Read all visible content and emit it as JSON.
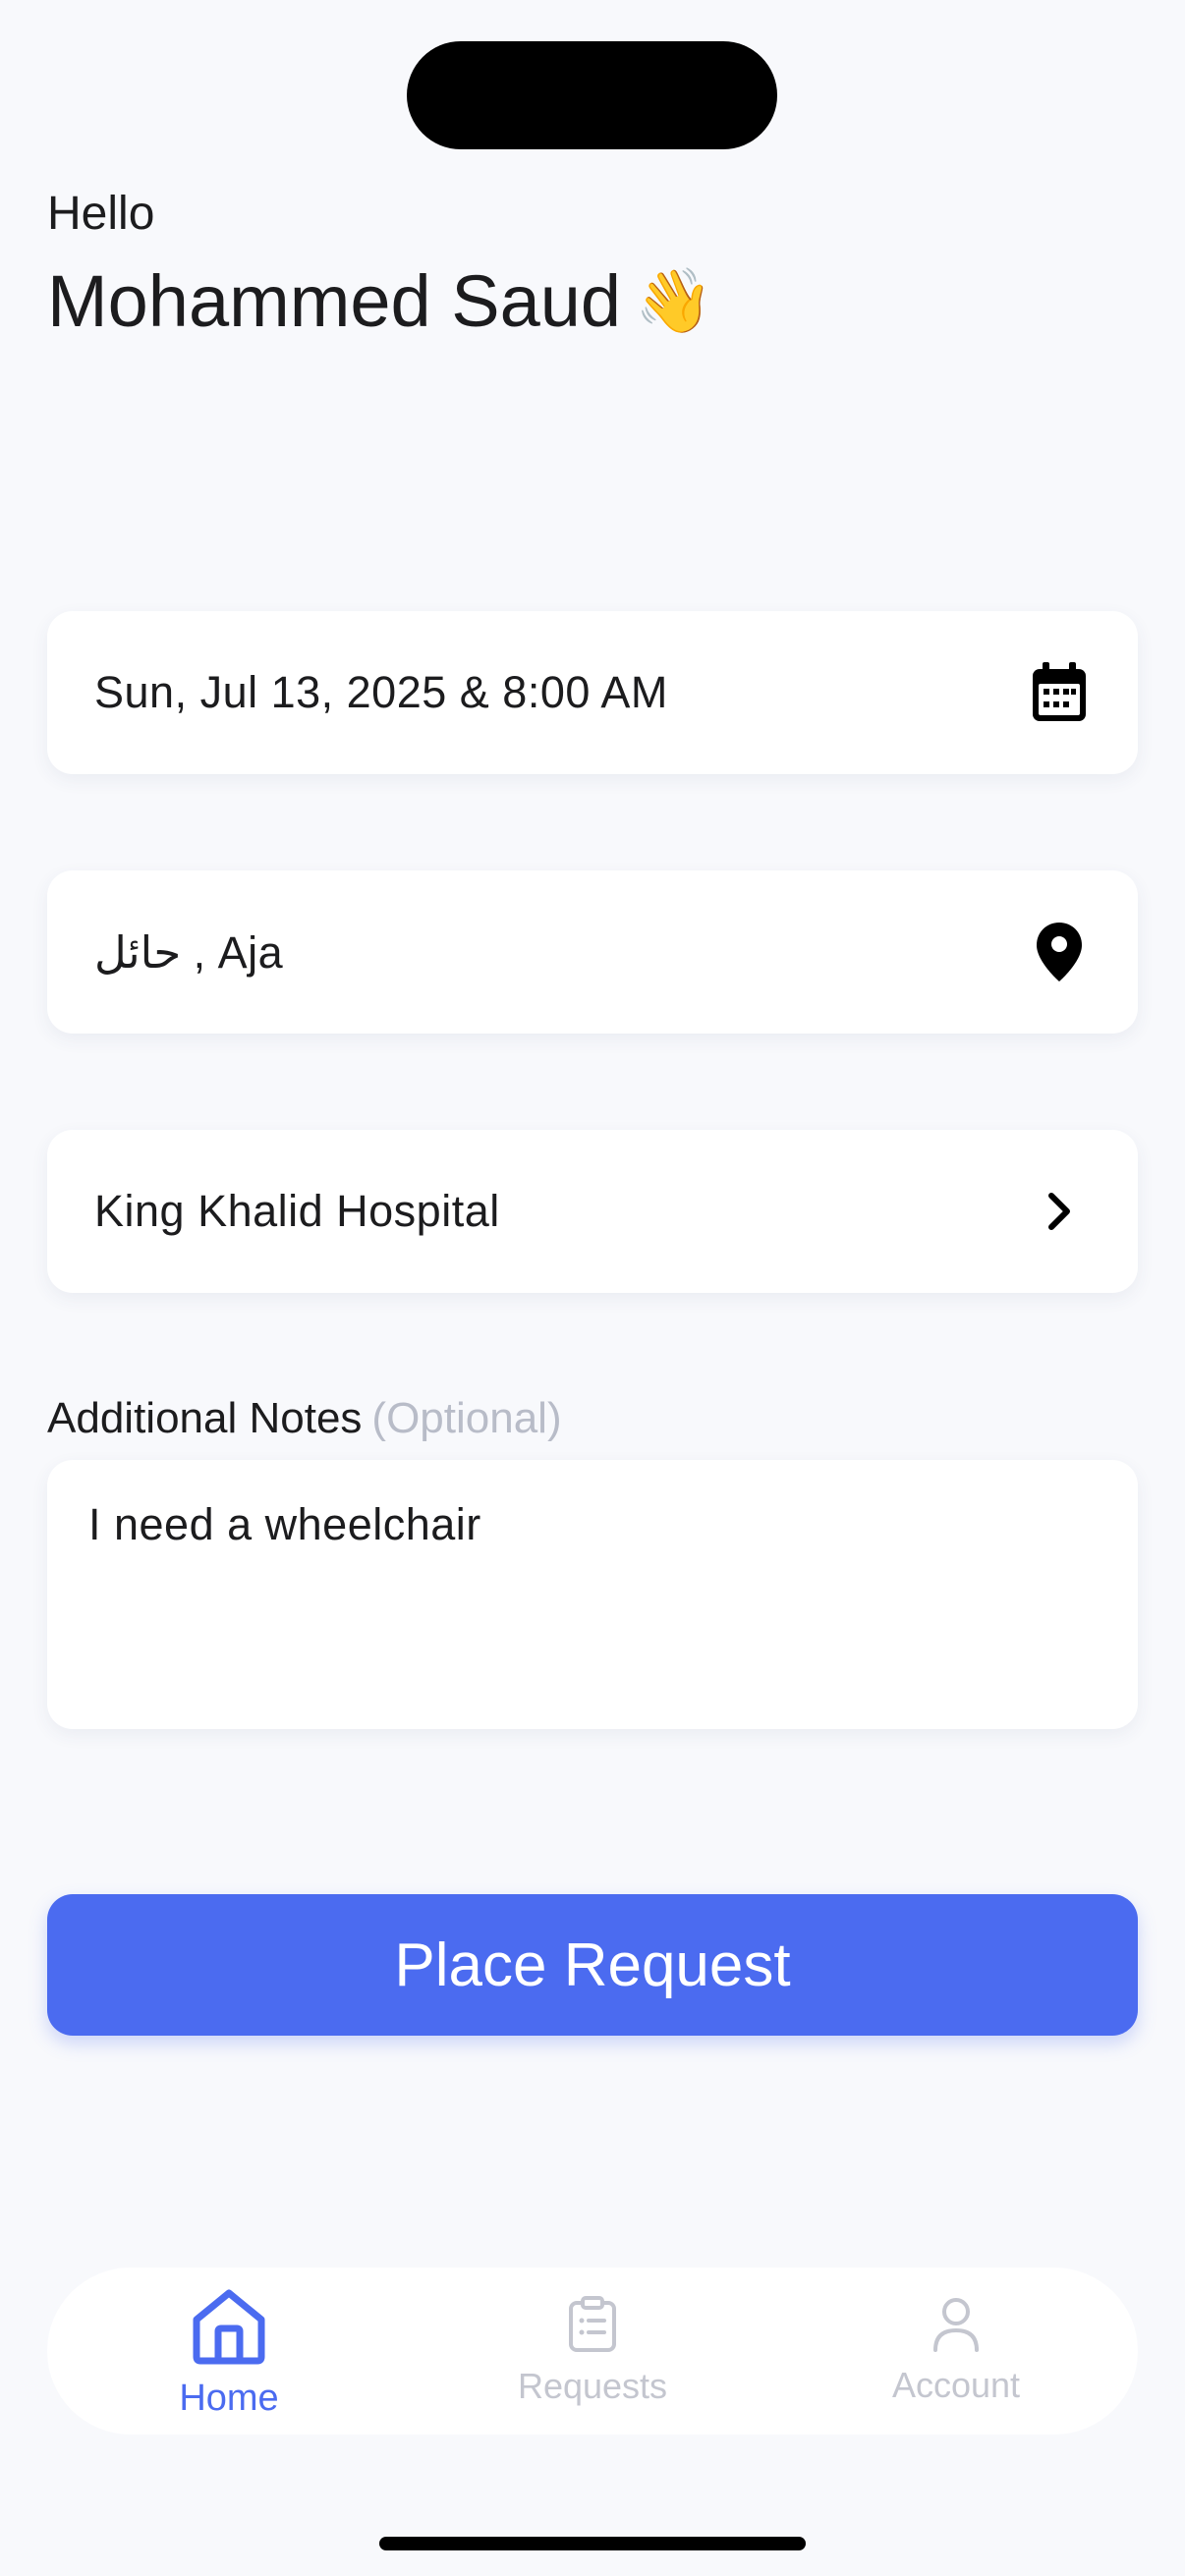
{
  "header": {
    "greeting": "Hello",
    "user_name": "Mohammed Saud",
    "wave_emoji": "👋"
  },
  "form": {
    "datetime_value": "Sun, Jul 13, 2025 & 8:00 AM",
    "datetime_icon": "calendar-icon",
    "location_value": "حائل , Aja",
    "location_icon": "map-pin-icon",
    "hospital_value": "King Khalid Hospital",
    "hospital_icon": "chevron-right-icon",
    "notes_label": "Additional Notes",
    "notes_optional": "(Optional)",
    "notes_value": "I need a wheelchair"
  },
  "cta": {
    "label": "Place Request"
  },
  "tabbar": {
    "tabs": [
      {
        "label": "Home",
        "icon": "home-icon",
        "active": true
      },
      {
        "label": "Requests",
        "icon": "clipboard-icon",
        "active": false
      },
      {
        "label": "Account",
        "icon": "user-icon",
        "active": false
      }
    ]
  },
  "colors": {
    "accent": "#4b6bf0",
    "background": "#f8f9fc",
    "inactive": "#c4c6cf",
    "optional_text": "#b8bcc8"
  }
}
